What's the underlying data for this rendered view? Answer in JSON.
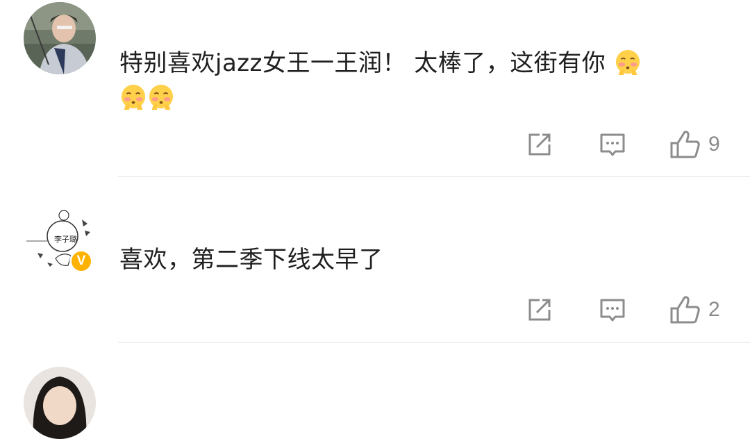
{
  "comments": [
    {
      "text": "特别喜欢jazz女王一王润！ 太棒了，这街有你",
      "emoji_count": 3,
      "like_count": "9",
      "verified": false
    },
    {
      "text": "喜欢，第二季下线太早了",
      "avatar_text": "李子璐",
      "like_count": "2",
      "verified": true
    }
  ],
  "icons": {
    "share": "share-icon",
    "reply": "comment-icon",
    "like": "thumbs-up-icon",
    "verified": "verified-badge-icon",
    "emoji": "blushing-face-emoji"
  },
  "colors": {
    "icon": "#8c8c8c",
    "verified": "#ffb300",
    "divider": "#efefef"
  }
}
